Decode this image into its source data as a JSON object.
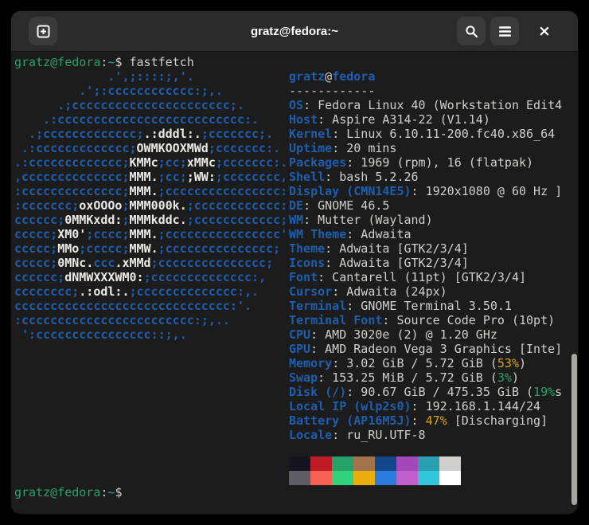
{
  "window": {
    "title": "gratz@fedora:~"
  },
  "header": {
    "icons": {
      "new_tab": "square-plus",
      "search": "magnifier",
      "menu": "hamburger",
      "close": "×"
    }
  },
  "colors": {
    "terminal_background": "#1c1c1c",
    "headerbar_background": "#2b2b2b",
    "foreground": "#d0cfcc",
    "logo_blue": "#1d5fae",
    "prompt_green": "#2aa06a",
    "prompt_teal": "#2aa1b3",
    "percent_yellow": "#d9a40e",
    "percent_green": "#26a269"
  },
  "terminal": {
    "command_line": [
      {
        "t": "gratz@fedora",
        "c": "green"
      },
      {
        "t": ":",
        "c": "f"
      },
      {
        "t": "~",
        "c": "teal"
      },
      {
        "t": "$ fastfetch",
        "c": "f"
      }
    ],
    "prompt_line": [
      {
        "t": "gratz@fedora",
        "c": "green"
      },
      {
        "t": ":",
        "c": "f"
      },
      {
        "t": "~",
        "c": "teal"
      },
      {
        "t": "$ ",
        "c": "f"
      }
    ],
    "logo_lines": [
      [
        {
          "t": "             .',;::::;,'.",
          "c": "b"
        }
      ],
      [
        {
          "t": "         .';:cccccccccccc:;,.",
          "c": "b"
        }
      ],
      [
        {
          "t": "      .;cccccccccccccccccccccc;.",
          "c": "b"
        }
      ],
      [
        {
          "t": "    .:cccccccccccccccccccccccccc:.",
          "c": "b"
        }
      ],
      [
        {
          "t": "  .;ccccccccccccc;",
          "c": "b"
        },
        {
          "t": ".:dddl:.",
          "c": "w"
        },
        {
          "t": ";ccccccc;.",
          "c": "b"
        }
      ],
      [
        {
          "t": " .:ccccccccccccc;",
          "c": "b"
        },
        {
          "t": "OWMKOOXMWd",
          "c": "w"
        },
        {
          "t": ";ccccccc:.",
          "c": "b"
        }
      ],
      [
        {
          "t": ".:ccccccccccccc;",
          "c": "b"
        },
        {
          "t": "KMMc",
          "c": "w"
        },
        {
          "t": ";cc;",
          "c": "b"
        },
        {
          "t": "xMMc",
          "c": "w"
        },
        {
          "t": ";ccccccc:.",
          "c": "b"
        }
      ],
      [
        {
          "t": ",cccccccccccccc;",
          "c": "b"
        },
        {
          "t": "MMM.",
          "c": "w"
        },
        {
          "t": ";cc;",
          "c": "b"
        },
        {
          "t": ";WW:",
          "c": "w"
        },
        {
          "t": ";cccccccc,",
          "c": "b"
        }
      ],
      [
        {
          "t": ":cccccccccccccc;",
          "c": "b"
        },
        {
          "t": "MMM.",
          "c": "w"
        },
        {
          "t": ";cccccccccccccccc:",
          "c": "b"
        }
      ],
      [
        {
          "t": ":ccccccc;",
          "c": "b"
        },
        {
          "t": "oxOOOo",
          "c": "w"
        },
        {
          "t": ";",
          "c": "b"
        },
        {
          "t": "MMM000k.",
          "c": "w"
        },
        {
          "t": ";cccccccccccc:",
          "c": "b"
        }
      ],
      [
        {
          "t": "cccccc;",
          "c": "b"
        },
        {
          "t": "0MMKxdd:",
          "c": "w"
        },
        {
          "t": ";",
          "c": "b"
        },
        {
          "t": "MMMkddc.",
          "c": "w"
        },
        {
          "t": ";cccccccccccc;",
          "c": "b"
        }
      ],
      [
        {
          "t": "ccccc;",
          "c": "b"
        },
        {
          "t": "XM0'",
          "c": "w"
        },
        {
          "t": ";cccc;",
          "c": "b"
        },
        {
          "t": "MMM.",
          "c": "w"
        },
        {
          "t": ";cccccccccccccccc'",
          "c": "b"
        }
      ],
      [
        {
          "t": "ccccc;",
          "c": "b"
        },
        {
          "t": "MMo",
          "c": "w"
        },
        {
          "t": ";ccccc;",
          "c": "b"
        },
        {
          "t": "MMW.",
          "c": "w"
        },
        {
          "t": ";ccccccccccccccc;",
          "c": "b"
        }
      ],
      [
        {
          "t": "ccccc;",
          "c": "b"
        },
        {
          "t": "0MNc.",
          "c": "w"
        },
        {
          "t": "ccc",
          "c": "b"
        },
        {
          "t": ".xMMd",
          "c": "w"
        },
        {
          "t": ";ccccccccccccccc;",
          "c": "b"
        }
      ],
      [
        {
          "t": "cccccc;",
          "c": "b"
        },
        {
          "t": "dNMWXXXWM0:",
          "c": "w"
        },
        {
          "t": ";cccccccccccccc:,",
          "c": "b"
        }
      ],
      [
        {
          "t": "cccccccc;",
          "c": "b"
        },
        {
          "t": ".:odl:.",
          "c": "w"
        },
        {
          "t": ";cccccccccccccc:,.",
          "c": "b"
        }
      ],
      [
        {
          "t": "cccccccccccccccccccccccccccccc:'.",
          "c": "b"
        }
      ],
      [
        {
          "t": ":cccccccccccccccccccccccc:;,..",
          "c": "b"
        }
      ],
      [
        {
          "t": " ':cccccccccccccccc::;,.",
          "c": "b"
        }
      ]
    ],
    "info_lines": [
      [
        {
          "t": "gratz",
          "c": "b"
        },
        {
          "t": "@",
          "c": "f"
        },
        {
          "t": "fedora",
          "c": "b"
        }
      ],
      [
        {
          "t": "------------",
          "c": "f"
        }
      ],
      [
        {
          "t": "OS",
          "c": "b"
        },
        {
          "t": ": Fedora Linux 40 (Workstation Edit4",
          "c": "f"
        }
      ],
      [
        {
          "t": "Host",
          "c": "b"
        },
        {
          "t": ": Aspire A314-22 (V1.14)",
          "c": "f"
        }
      ],
      [
        {
          "t": "Kernel",
          "c": "b"
        },
        {
          "t": ": Linux 6.10.11-200.fc40.x86_64",
          "c": "f"
        }
      ],
      [
        {
          "t": "Uptime",
          "c": "b"
        },
        {
          "t": ": 20 mins",
          "c": "f"
        }
      ],
      [
        {
          "t": "Packages",
          "c": "b"
        },
        {
          "t": ": 1969 (rpm), 16 (flatpak)",
          "c": "f"
        }
      ],
      [
        {
          "t": "Shell",
          "c": "b"
        },
        {
          "t": ": bash 5.2.26",
          "c": "f"
        }
      ],
      [
        {
          "t": "Display (CMN14E5)",
          "c": "b"
        },
        {
          "t": ": 1920x1080 @ 60 Hz ]",
          "c": "f"
        }
      ],
      [
        {
          "t": "DE",
          "c": "b"
        },
        {
          "t": ": GNOME 46.5",
          "c": "f"
        }
      ],
      [
        {
          "t": "WM",
          "c": "b"
        },
        {
          "t": ": Mutter (Wayland)",
          "c": "f"
        }
      ],
      [
        {
          "t": "WM Theme",
          "c": "b"
        },
        {
          "t": ": Adwaita",
          "c": "f"
        }
      ],
      [
        {
          "t": "Theme",
          "c": "b"
        },
        {
          "t": ": Adwaita [GTK2/3/4]",
          "c": "f"
        }
      ],
      [
        {
          "t": "Icons",
          "c": "b"
        },
        {
          "t": ": Adwaita [GTK2/3/4]",
          "c": "f"
        }
      ],
      [
        {
          "t": "Font",
          "c": "b"
        },
        {
          "t": ": Cantarell (11pt) [GTK2/3/4]",
          "c": "f"
        }
      ],
      [
        {
          "t": "Cursor",
          "c": "b"
        },
        {
          "t": ": Adwaita (24px)",
          "c": "f"
        }
      ],
      [
        {
          "t": "Terminal",
          "c": "b"
        },
        {
          "t": ": GNOME Terminal 3.50.1",
          "c": "f"
        }
      ],
      [
        {
          "t": "Terminal Font",
          "c": "b"
        },
        {
          "t": ": Source Code Pro (10pt)",
          "c": "f"
        }
      ],
      [
        {
          "t": "CPU",
          "c": "b"
        },
        {
          "t": ": AMD 3020e (2) @ 1.20 GHz",
          "c": "f"
        }
      ],
      [
        {
          "t": "GPU",
          "c": "b"
        },
        {
          "t": ": AMD Radeon Vega 3 Graphics [Inte]",
          "c": "f"
        }
      ],
      [
        {
          "t": "Memory",
          "c": "b"
        },
        {
          "t": ": 3.02 GiB / 5.72 GiB (",
          "c": "f"
        },
        {
          "t": "53%",
          "c": "y"
        },
        {
          "t": ")",
          "c": "f"
        }
      ],
      [
        {
          "t": "Swap",
          "c": "b"
        },
        {
          "t": ": 153.25 MiB / 5.72 GiB (",
          "c": "f"
        },
        {
          "t": "3%",
          "c": "g"
        },
        {
          "t": ")",
          "c": "f"
        }
      ],
      [
        {
          "t": "Disk (/)",
          "c": "b"
        },
        {
          "t": ": 90.67 GiB / 475.35 GiB (",
          "c": "f"
        },
        {
          "t": "19%",
          "c": "g"
        },
        {
          "t": "s",
          "c": "f"
        }
      ],
      [
        {
          "t": "Local IP (wlp2s0)",
          "c": "b"
        },
        {
          "t": ": 192.168.1.144/24",
          "c": "f"
        }
      ],
      [
        {
          "t": "Battery (AP16M5J)",
          "c": "b"
        },
        {
          "t": ": ",
          "c": "f"
        },
        {
          "t": "47%",
          "c": "y"
        },
        {
          "t": " [Discharging]",
          "c": "f"
        }
      ],
      [
        {
          "t": "Locale",
          "c": "b"
        },
        {
          "t": ": ru_RU.UTF-8",
          "c": "f"
        }
      ]
    ],
    "palette": {
      "normal": [
        "#171421",
        "#c01c28",
        "#26a269",
        "#a2734c",
        "#12488b",
        "#a347ba",
        "#2aa1b3",
        "#d0cfcc"
      ],
      "bright": [
        "#5e5c64",
        "#f66151",
        "#33d17a",
        "#e9ad0c",
        "#2a7bde",
        "#c061cb",
        "#33c7de",
        "#ffffff"
      ]
    }
  }
}
